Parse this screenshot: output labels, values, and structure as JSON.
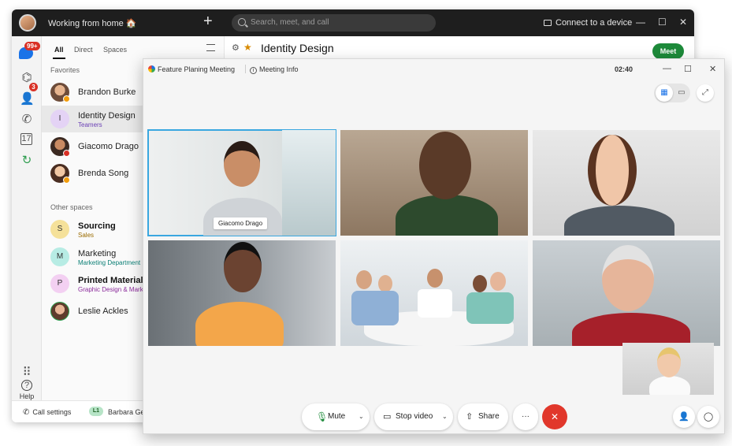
{
  "app": {
    "status": "Working from home 🏠",
    "search_placeholder": "Search, meet, and call",
    "connect_label": "Connect to a device"
  },
  "rail": {
    "chat_badge": "99+",
    "people_badge": "3",
    "help_label": "Help"
  },
  "tabs": [
    "All",
    "Direct",
    "Spaces"
  ],
  "sections": {
    "favorites": "Favorites",
    "other_spaces": "Other spaces"
  },
  "favorites": [
    {
      "name": "Brandon Burke",
      "avatar": "photo",
      "color": "#d9a27a"
    },
    {
      "name": "Identity Design",
      "sub": "Teamers",
      "avatar": "I",
      "color": "#e4d3f5"
    },
    {
      "name": "Giacomo Drago",
      "avatar": "photo",
      "color": "#8a5a44"
    },
    {
      "name": "Brenda Song",
      "avatar": "photo",
      "color": "#e3b48f"
    }
  ],
  "other_spaces": [
    {
      "name": "Sourcing",
      "sub": "Sales",
      "avatar": "S",
      "color": "#f5e19a",
      "sub_color": "#9a6b00",
      "bold": true
    },
    {
      "name": "Marketing",
      "sub": "Marketing Department",
      "avatar": "M",
      "color": "#b7ece4",
      "sub_color": "#0a7f75",
      "bold": false
    },
    {
      "name": "Printed Material",
      "sub": "Graphic Design & Marketing",
      "avatar": "P",
      "color": "#f3d0f2",
      "sub_color": "#8b2a9b",
      "bold": true
    },
    {
      "name": "Leslie Ackles",
      "avatar": "photo",
      "color": "#c98d6d"
    }
  ],
  "footer": {
    "call_settings": "Call settings",
    "user_initials": "L1",
    "user_name": "Barbara German"
  },
  "space": {
    "title": "Identity Design",
    "meet_button": "Meet"
  },
  "meeting": {
    "title": "Feature Planing Meeting",
    "info": "Meeting Info",
    "timer": "02:40",
    "active_speaker": "Giacomo Drago",
    "controls": {
      "mute": "Mute",
      "stop_video": "Stop video",
      "share": "Share",
      "more": "···"
    }
  },
  "colors": {
    "accent_green": "#1d8a3a",
    "end_call": "#e1372b",
    "active_outline": "#3aa7e0"
  }
}
